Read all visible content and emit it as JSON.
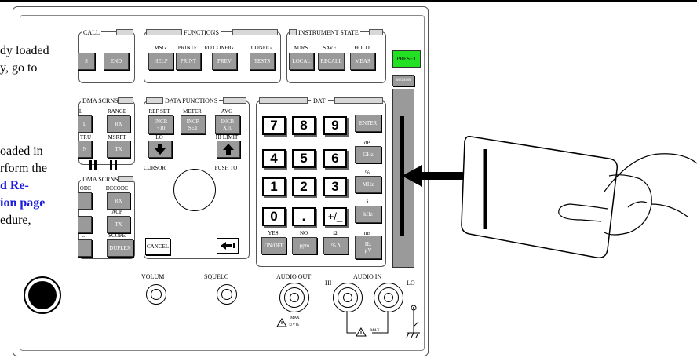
{
  "text_fragments": [
    "dy loaded",
    "y, go to",
    "oaded in",
    "rform the",
    "d Re-",
    "ion page",
    "edure,"
  ],
  "groups": {
    "call": "CALL",
    "functions": "FUNCTIONS",
    "instrument_state": "INSTRUMENT STATE",
    "dma_scrns_1": "DMA SCRNS",
    "data_functions": "DATA FUNCTIONS",
    "dat": "DAT",
    "dma_scrns_2": "DMA SCRNS"
  },
  "keys": {
    "call_left": "S",
    "end": "END",
    "help": "HELP",
    "print": "PRINT",
    "prev": "PREV",
    "tests": "TESTS",
    "local": "LOCAL",
    "recall": "RECALL",
    "meas": "MEAS",
    "preset": "PRESET",
    "memor": "MEMOR",
    "l": "L",
    "rx": "RX",
    "n": "N",
    "tx": "TX",
    "incr_div10": "INCR\n÷10",
    "incr_set": "INCR\nSET",
    "incr_x10": "INCR\nX10",
    "rx2": "RX",
    "tx2": "TX",
    "duplex": "DUPLEX",
    "cancel": "CANCEL",
    "enter": "ENTER",
    "ghz": "GHz",
    "mhz": "MHz",
    "khz": "kHz",
    "onoff": "ON/OFF",
    "ppm": "ppm",
    "pct_delta": "% Δ",
    "hz_uv": "Hz\nµV"
  },
  "key_labels": {
    "msg": "MSG",
    "printe": "PRINTE",
    "io_config": "I/O CONFIG",
    "config": "CONFIG",
    "adrs": "ADRS",
    "save": "SAVE",
    "hold": "HOLD",
    "range": "RANGE",
    "l_top": "L",
    "tru": "TRU",
    "msrpt": "MSRPT",
    "ref_set": "REF SET",
    "meter": "METER",
    "avg": "AVG",
    "lo": "LO",
    "hi_limit": "HI LIMIT",
    "cursor": "CURSOR",
    "push_to": "PUSH TO",
    "ode": "ODE",
    "decode": "DECODE",
    "acp": "ACP",
    "c": "C",
    "scope": "SCOPE",
    "db": "dB",
    "pct": "%",
    "s": "s",
    "ms": "ms",
    "yes": "YES",
    "no": "NO",
    "ohm": "Ω",
    "volum": "VOLUM",
    "squelc": "SQUELC",
    "audio_out": "AUDIO OUT",
    "audio_in": "AUDIO IN",
    "hi": "HI",
    "lo2": "LO",
    "max1": "MAX",
    "max1_sub": "12 V Pk",
    "max2": "MAX"
  },
  "numpad": [
    "7",
    "8",
    "9",
    "4",
    "5",
    "6",
    "1",
    "2",
    "3",
    "0",
    ".",
    "+/_"
  ],
  "colors": {
    "preset_green": "#22e022",
    "link_blue": "#1a1ae0",
    "key_gray": "#9a9a9a"
  },
  "icons": [
    "down-arrow-icon",
    "up-arrow-icon",
    "backspace-arrow-icon",
    "insert-card-arrow-icon",
    "hand-holding-card-icon",
    "ground-icon",
    "warning-triangle-icon"
  ]
}
